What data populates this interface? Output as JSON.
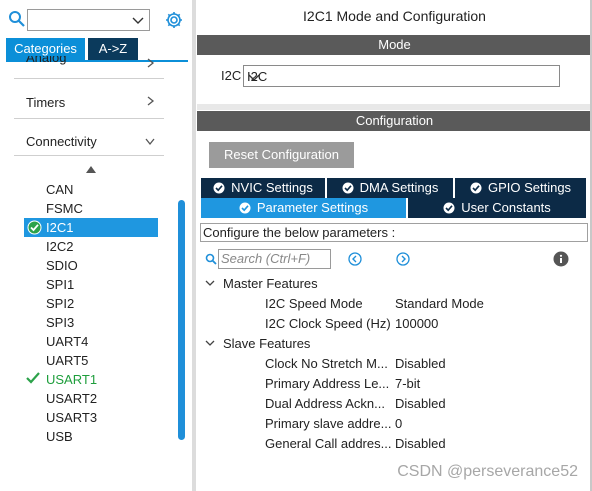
{
  "sidebar": {
    "tabs": {
      "categories": "Categories",
      "az": "A->Z"
    },
    "categories": [
      {
        "label": "Analog"
      },
      {
        "label": "Timers"
      },
      {
        "label": "Connectivity"
      }
    ],
    "peripherals": [
      "CAN",
      "FSMC",
      "I2C1",
      "I2C2",
      "SDIO",
      "SPI1",
      "SPI2",
      "SPI3",
      "UART4",
      "UART5",
      "USART1",
      "USART2",
      "USART3",
      "USB"
    ],
    "selected": "I2C1",
    "enabled_color": "#1e9e3c",
    "accent": "#0b8fd8"
  },
  "main": {
    "title": "I2C1 Mode and Configuration",
    "mode_header": "Mode",
    "mode_field_label": "I2C",
    "mode_field_value": "I2C",
    "config_header": "Configuration",
    "reset_button": "Reset Configuration",
    "tabs_row1": [
      "NVIC Settings",
      "DMA Settings",
      "GPIO Settings"
    ],
    "tabs_row2": [
      "Parameter Settings",
      "User Constants"
    ],
    "active_tab": "Parameter Settings",
    "hint": "Configure the below parameters :",
    "search_placeholder": "Search (Ctrl+F)",
    "groups": [
      {
        "name": "Master Features",
        "params": [
          {
            "name": "I2C Speed Mode",
            "value": "Standard Mode"
          },
          {
            "name": "I2C Clock Speed (Hz)",
            "value": "100000"
          }
        ]
      },
      {
        "name": "Slave Features",
        "params": [
          {
            "name": "Clock No Stretch M...",
            "value": "Disabled"
          },
          {
            "name": "Primary Address Le...",
            "value": "7-bit"
          },
          {
            "name": "Dual Address Ackn...",
            "value": "Disabled"
          },
          {
            "name": "Primary slave addre...",
            "value": "0"
          },
          {
            "name": "General Call addres...",
            "value": "Disabled"
          }
        ]
      }
    ]
  },
  "watermark": "CSDN @perseverance52"
}
